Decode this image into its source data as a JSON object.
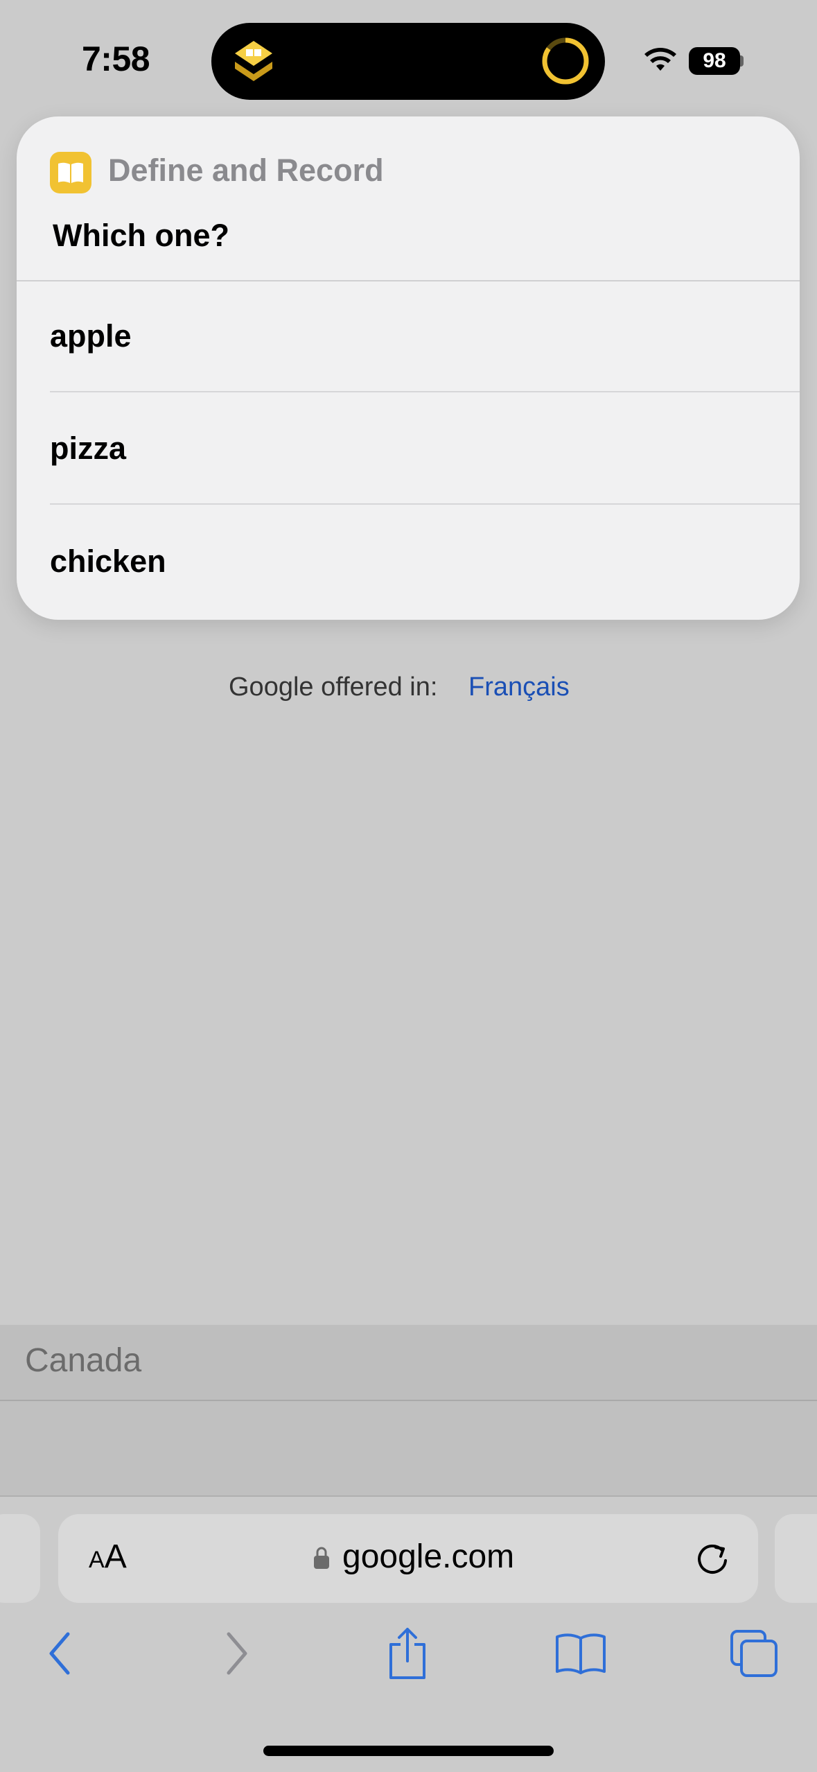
{
  "status": {
    "time": "7:58",
    "battery": "98"
  },
  "prompt_sheet": {
    "app_name": "Define and Record",
    "question": "Which one?",
    "options": [
      "apple",
      "pizza",
      "chicken"
    ]
  },
  "page": {
    "offered_text": "Google offered in:",
    "language_link": "Français",
    "region": "Canada"
  },
  "browser": {
    "text_size_label_small": "A",
    "text_size_label_large": "A",
    "url": "google.com"
  },
  "colors": {
    "accent": "#2f6fd8",
    "app_icon": "#f1c232",
    "link": "#1a4fb5"
  }
}
